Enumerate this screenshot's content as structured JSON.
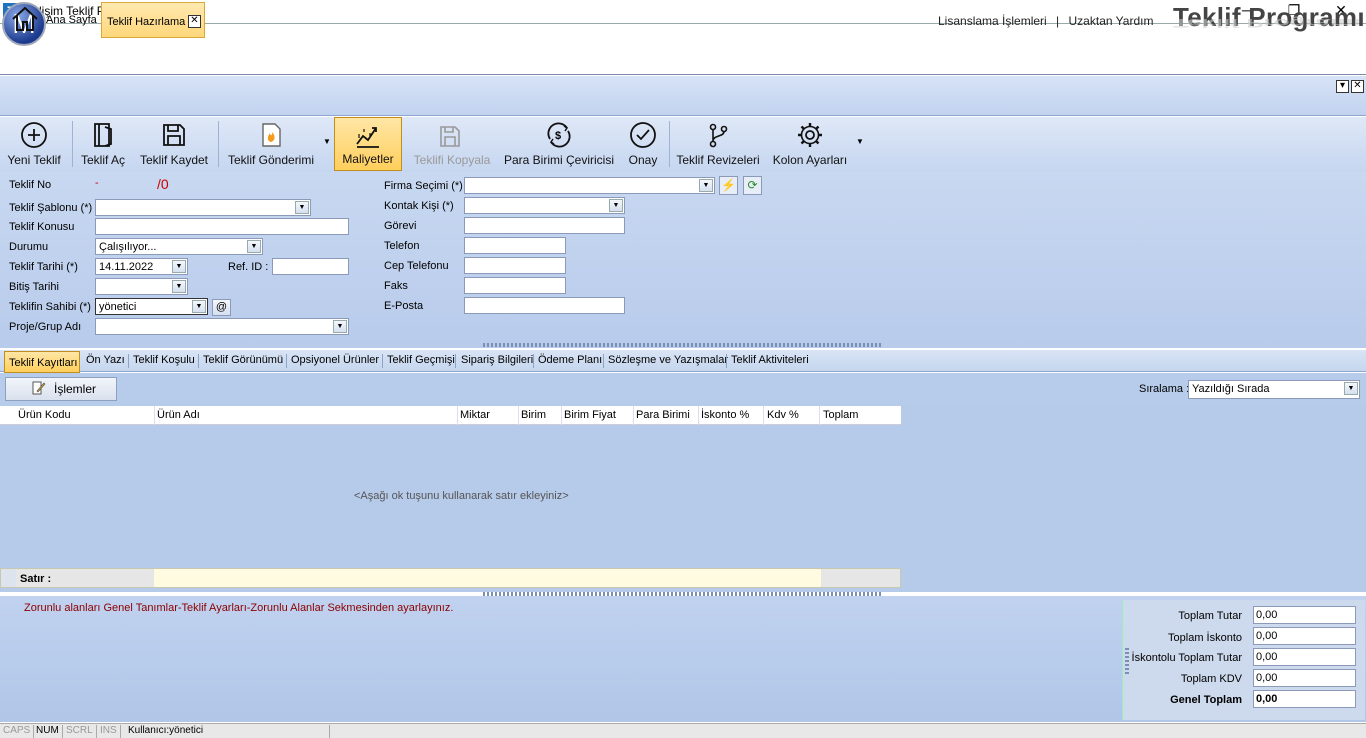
{
  "window": {
    "title": "Gelişim Teklif Programı",
    "app_icon_letter": "T",
    "minimize": "─",
    "restore": "❐",
    "close": "✕"
  },
  "header": {
    "logo_letter": "M",
    "link_license": "Lisanslama İşlemleri",
    "link_sep": "|",
    "link_remote": "Uzaktan Yardım",
    "brand": "Teklif Programı"
  },
  "tabs": {
    "home": "Ana Sayfa",
    "active": "Teklif Hazırlama",
    "close": "✕"
  },
  "ribbon": {
    "new": "Yeni Teklif",
    "open": "Teklif Aç",
    "save": "Teklif Kaydet",
    "send": "Teklif Gönderimi",
    "costs": "Maliyetler",
    "copy": "Teklifi Kopyala",
    "currency": "Para Birimi Çeviricisi",
    "approve": "Onay",
    "revisions": "Teklif Revizeleri",
    "columns": "Kolon Ayarları"
  },
  "form": {
    "no_label": "Teklif No",
    "no_dash": "-",
    "no_value": "/0",
    "template_label": "Teklif Şablonu (*)",
    "template_value": "",
    "subject_label": "Teklif Konusu",
    "subject_value": "",
    "status_label": "Durumu",
    "status_value": "Çalışılıyor...",
    "date_label": "Teklif Tarihi (*)",
    "date_value": "14.11.2022",
    "ref_label": "Ref. ID :",
    "ref_value": "",
    "end_label": "Bitiş Tarihi",
    "end_value": "",
    "owner_label": "Teklifin Sahibi (*)",
    "owner_value": "yönetici",
    "owner_at": "@",
    "project_label": "Proje/Grup Adı",
    "project_value": "",
    "firm_label": "Firma Seçimi (*)",
    "contact_label": "Kontak Kişi (*)",
    "role_label": "Görevi",
    "phone_label": "Telefon",
    "mobile_label": "Cep Telefonu",
    "fax_label": "Faks",
    "email_label": "E-Posta"
  },
  "subtabs": [
    "Teklif Kayıtları",
    "Ön Yazı",
    "Teklif Koşulu",
    "Teklif Görünümü",
    "Opsiyonel Ürünler",
    "Teklif Geçmişi",
    "Sipariş Bilgileri",
    "Ödeme Planı",
    "Sözleşme ve Yazışmalar",
    "Teklif Aktiviteleri"
  ],
  "toolbar": {
    "actions": "İşlemler",
    "sort_label": "Sıralama :",
    "sort_value": "Yazıldığı Sırada"
  },
  "grid": {
    "columns": [
      "Ürün Kodu",
      "Ürün Adı",
      "Miktar",
      "Birim",
      "Birim Fiyat",
      "Para Birimi",
      "İskonto %",
      "Kdv %",
      "Toplam"
    ],
    "empty_text": "<Aşağı ok tuşunu kullanarak satır ekleyiniz>",
    "row_label": "Satır :"
  },
  "bottom": {
    "warning": "Zorunlu alanları Genel Tanımlar-Teklif Ayarları-Zorunlu Alanlar Sekmesinden ayarlayınız."
  },
  "totals": [
    {
      "label": "Toplam Tutar",
      "value": "0,00"
    },
    {
      "label": "Toplam İskonto",
      "value": "0,00"
    },
    {
      "label": "İskontolu Toplam Tutar",
      "value": "0,00"
    },
    {
      "label": "Toplam KDV",
      "value": "0,00"
    },
    {
      "label": "Genel Toplam",
      "value": "0,00"
    }
  ],
  "status": {
    "caps": "CAPS",
    "num": "NUM",
    "scrl": "SCRL",
    "ins": "INS",
    "user": "Kullanıcı:yönetici"
  }
}
